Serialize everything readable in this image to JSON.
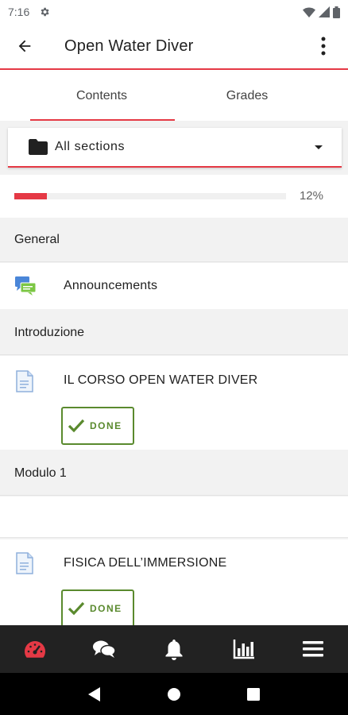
{
  "status_bar": {
    "time": "7:16"
  },
  "app_bar": {
    "title": "Open Water Diver"
  },
  "tabs": [
    {
      "label": "Contents",
      "active": true
    },
    {
      "label": "Grades",
      "active": false
    }
  ],
  "section_selector": {
    "label": "All sections"
  },
  "progress": {
    "value": 0.12,
    "text": "12%"
  },
  "sections": [
    {
      "title": "General",
      "modules": [
        {
          "name": "Announcements",
          "icon": "forum-icon"
        }
      ]
    },
    {
      "title": "Introduzione",
      "modules": [
        {
          "name": "IL CORSO OPEN WATER DIVER",
          "icon": "page-icon",
          "completion": "DONE"
        }
      ]
    },
    {
      "title": "Modulo 1",
      "modules": [
        {
          "name": "FISICA DELL’IMMERSIONE",
          "icon": "page-icon",
          "completion": "DONE"
        }
      ]
    }
  ],
  "bottom_nav": [
    "dashboard-icon",
    "messages-icon",
    "notifications-icon",
    "grades-icon",
    "menu-icon"
  ],
  "colors": {
    "accent": "#e53945",
    "done": "#5a8a2e",
    "nav_bg": "#222222"
  }
}
